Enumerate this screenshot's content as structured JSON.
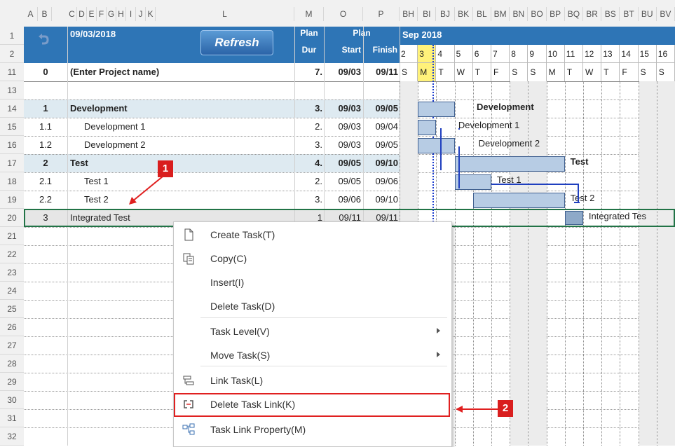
{
  "columns": {
    "letters": [
      "A",
      "B",
      "C",
      "D",
      "E",
      "F",
      "G",
      "H",
      "I",
      "J",
      "K",
      "L",
      "M",
      "O",
      "P"
    ],
    "gantt_letters": [
      "BH",
      "BI",
      "BJ",
      "BK",
      "BL",
      "BM",
      "BN",
      "BO",
      "BP",
      "BQ",
      "BR",
      "BS",
      "BT",
      "BU",
      "BV"
    ]
  },
  "header": {
    "date": "09/03/2018",
    "refresh": "Refresh",
    "plan": "Plan",
    "dur": "Dur",
    "plan2": "Plan",
    "start": "Start",
    "finish": "Finish",
    "month": "Sep 2018",
    "days": [
      "2",
      "3",
      "4",
      "5",
      "6",
      "7",
      "8",
      "9",
      "10",
      "11",
      "12",
      "13",
      "14",
      "15",
      "16"
    ],
    "weekdays": [
      "S",
      "M",
      "T",
      "W",
      "T",
      "F",
      "S",
      "S",
      "M",
      "T",
      "W",
      "T",
      "F",
      "S",
      "S"
    ]
  },
  "rownums": [
    "1",
    "2",
    "11",
    "13",
    "14",
    "15",
    "16",
    "17",
    "18",
    "19",
    "20",
    "21",
    "22",
    "23",
    "24",
    "25",
    "26",
    "27",
    "28",
    "29",
    "30",
    "31",
    "32"
  ],
  "tasks": [
    {
      "num": "0",
      "name": "(Enter Project name)",
      "dur": "7.",
      "start": "09/03",
      "finish": "09/11",
      "bold": true
    },
    {
      "num": "1",
      "name": "Development",
      "dur": "3.",
      "start": "09/03",
      "finish": "09/05",
      "bold": true
    },
    {
      "num": "1.1",
      "name": "Development 1",
      "dur": "2.",
      "start": "09/03",
      "finish": "09/04",
      "bold": false
    },
    {
      "num": "1.2",
      "name": "Development 2",
      "dur": "3.",
      "start": "09/03",
      "finish": "09/05",
      "bold": false
    },
    {
      "num": "2",
      "name": "Test",
      "dur": "4.",
      "start": "09/05",
      "finish": "09/10",
      "bold": true
    },
    {
      "num": "2.1",
      "name": "Test 1",
      "dur": "2.",
      "start": "09/05",
      "finish": "09/06",
      "bold": false
    },
    {
      "num": "2.2",
      "name": "Test 2",
      "dur": "3.",
      "start": "09/06",
      "finish": "09/10",
      "bold": false
    },
    {
      "num": "3",
      "name": "Integrated Test",
      "dur": "1",
      "start": "09/11",
      "finish": "09/11",
      "bold": false
    }
  ],
  "gantt_labels": [
    "Development",
    "Development 1",
    "Development 2",
    "Test",
    "Test 1",
    "Test 2",
    "Integrated Tes"
  ],
  "menu": {
    "items": [
      {
        "label": "Create Task(T)",
        "icon": "create-task-icon"
      },
      {
        "label": "Copy(C)",
        "icon": "copy-icon"
      },
      {
        "label": "Insert(I)",
        "icon": ""
      },
      {
        "label": "Delete Task(D)",
        "icon": ""
      },
      {
        "label": "Task Level(V)",
        "icon": "",
        "submenu": true
      },
      {
        "label": "Move Task(S)",
        "icon": "",
        "submenu": true
      },
      {
        "label": "Link Task(L)",
        "icon": "link-task-icon"
      },
      {
        "label": "Delete Task Link(K)",
        "icon": "delete-link-icon",
        "highlighted": true
      },
      {
        "label": "Task Link Property(M)",
        "icon": "link-property-icon"
      }
    ]
  },
  "callouts": [
    "1",
    "2"
  ],
  "colors": {
    "header_blue": "#2e75b6",
    "section_bg": "#deeaf1",
    "bar_fill": "#b7cce4",
    "today": "#fff27a",
    "highlight": "#e02020"
  }
}
